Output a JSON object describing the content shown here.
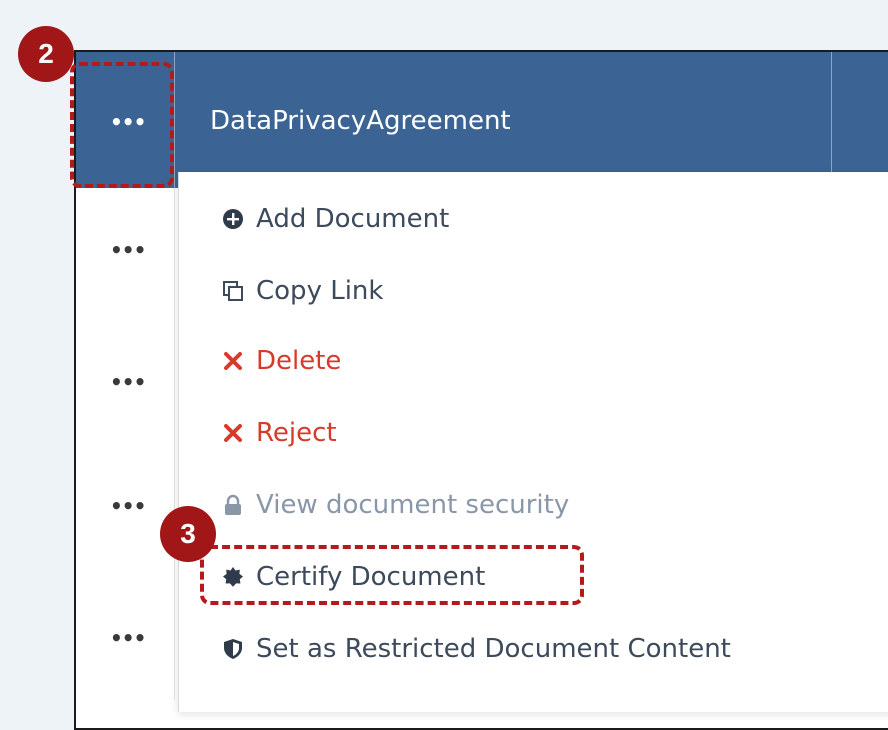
{
  "header": {
    "title": "DataPrivacyAgreement",
    "menu_dots": "•••"
  },
  "rows": [
    {
      "dots": "•••"
    },
    {
      "dots": "•••"
    },
    {
      "dots": "•••"
    },
    {
      "dots": "•••"
    }
  ],
  "menu": {
    "items": [
      {
        "label": "Add Document",
        "icon": "plus-circle-icon",
        "state": "normal"
      },
      {
        "label": "Copy Link",
        "icon": "copy-icon",
        "state": "normal"
      },
      {
        "label": "Delete",
        "icon": "x-icon",
        "state": "danger"
      },
      {
        "label": "Reject",
        "icon": "x-icon",
        "state": "danger"
      },
      {
        "label": "View document security",
        "icon": "lock-icon",
        "state": "disabled"
      },
      {
        "label": "Certify Document",
        "icon": "certificate-icon",
        "state": "normal"
      },
      {
        "label": "Set as Restricted Document Content",
        "icon": "shield-icon",
        "state": "normal"
      }
    ]
  },
  "annotations": {
    "step_2": "2",
    "step_3": "3"
  },
  "colors": {
    "header_bg": "#3b6494",
    "badge": "#a11718",
    "danger": "#d83a2a"
  }
}
